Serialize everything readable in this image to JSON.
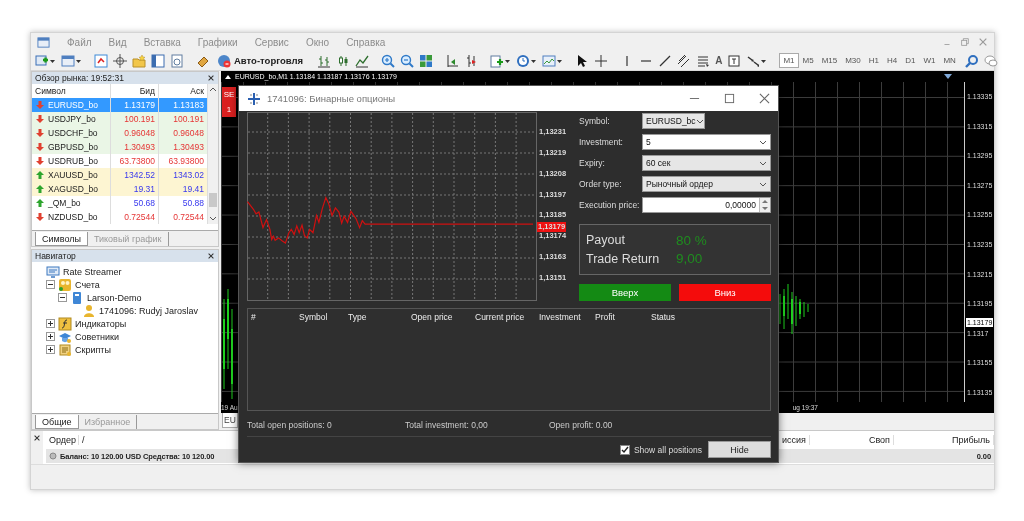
{
  "menu": [
    "Файл",
    "Вид",
    "Вставка",
    "Графики",
    "Сервис",
    "Окно",
    "Справка"
  ],
  "toolbar": {
    "auto_trading": "Авто-торговля",
    "text_tool": "A",
    "timeframes": [
      {
        "label": "M1",
        "selected": true
      },
      {
        "label": "M5",
        "selected": false
      },
      {
        "label": "M15",
        "selected": false
      },
      {
        "label": "M30",
        "selected": false
      },
      {
        "label": "H1",
        "selected": false
      },
      {
        "label": "H4",
        "selected": false
      },
      {
        "label": "D1",
        "selected": false
      },
      {
        "label": "W1",
        "selected": false
      },
      {
        "label": "MN",
        "selected": false
      }
    ]
  },
  "market_watch": {
    "title": "Обзор рынка: 19:52:31",
    "columns": [
      "Символ",
      "Бид",
      "Аск"
    ],
    "rows": [
      {
        "symbol": "EURUSD_bo",
        "bid": "1.13179",
        "ask": "1.13183",
        "kind": "down",
        "selected": true
      },
      {
        "symbol": "USDJPY_bo",
        "bid": "100.191",
        "ask": "100.191",
        "kind": "down",
        "selected": false,
        "color": "#eaf6e6"
      },
      {
        "symbol": "USDCHF_bo",
        "bid": "0.96048",
        "ask": "0.96048",
        "kind": "down",
        "selected": false,
        "color": "#eaf6e6"
      },
      {
        "symbol": "GBPUSD_bo",
        "bid": "1.30493",
        "ask": "1.30493",
        "kind": "down",
        "selected": false,
        "color": "#eaf6e6"
      },
      {
        "symbol": "USDRUB_bo",
        "bid": "63.73800",
        "ask": "63.93800",
        "kind": "down",
        "selected": false,
        "color": "#ffffff"
      },
      {
        "symbol": "XAUUSD_bo",
        "bid": "1342.52",
        "ask": "1343.02",
        "kind": "up",
        "selected": false,
        "color": "#fdf5d2"
      },
      {
        "symbol": "XAGUSD_bo",
        "bid": "19.31",
        "ask": "19.41",
        "kind": "up",
        "selected": false,
        "color": "#fdf5d2"
      },
      {
        "symbol": "_QM_bo",
        "bid": "50.68",
        "ask": "50.88",
        "kind": "up",
        "selected": false,
        "color": "#ffffff"
      },
      {
        "symbol": "NZDUSD_bo",
        "bid": "0.72544",
        "ask": "0.72544",
        "kind": "down",
        "selected": false,
        "color": "#ffffff"
      }
    ],
    "tabs": [
      {
        "label": "Символы",
        "selected": true
      },
      {
        "label": "Тиковый график",
        "selected": false
      }
    ]
  },
  "navigator": {
    "title": "Навигатор",
    "tree": [
      {
        "label": "Rate Streamer",
        "kind": "root",
        "children": [
          {
            "label": "Счета",
            "kind": "accounts",
            "expanded": true,
            "children": [
              {
                "label": "Larson-Demo",
                "kind": "server",
                "expanded": true,
                "children": [
                  {
                    "label": "1741096: Rudyj Jaroslav",
                    "kind": "account"
                  }
                ]
              }
            ]
          },
          {
            "label": "Индикаторы",
            "kind": "indicators",
            "expanded": false
          },
          {
            "label": "Советники",
            "kind": "experts",
            "expanded": false
          },
          {
            "label": "Скрипты",
            "kind": "scripts",
            "expanded": false
          }
        ]
      }
    ],
    "tabs": [
      {
        "label": "Общие",
        "selected": true
      },
      {
        "label": "Избранное",
        "selected": false
      }
    ]
  },
  "chart": {
    "title": "EURUSD_bo,M1 1.13184 1.13187 1.13176 1.13179",
    "sell_label": "SE",
    "sell_price": "1",
    "price_labels": [
      "1.13335",
      "1.13315",
      "1.13295",
      "1.13275",
      "1.13255",
      "1.13235",
      "1.13215",
      "1.13195",
      "1.1317",
      "1.13155",
      "1.13135"
    ],
    "current_price": "1.13179",
    "time_labels": [
      "19 Au",
      "ug 19:37"
    ],
    "tab": "EU"
  },
  "dialog": {
    "title": "1741096: Бинарные опционы",
    "price_labels": [
      "1,13231",
      "1,13219",
      "1,13208",
      "1,13197",
      "1,13185",
      "1,13174",
      "1,13163",
      "1,13151"
    ],
    "current_price": "1,13179",
    "form": [
      {
        "label": "Symbol:",
        "value": "EURUSD_bc",
        "kind": "short-select"
      },
      {
        "label": "Investment:",
        "value": "5",
        "kind": "combo"
      },
      {
        "label": "Expiry:",
        "value": "60 сек",
        "kind": "dropdown"
      },
      {
        "label": "Order type:",
        "value": "Рыночный ордер",
        "kind": "dropdown"
      },
      {
        "label": "Execution price:",
        "value": "0,00000",
        "kind": "spin"
      }
    ],
    "payout": {
      "label": "Payout",
      "value": "80 %"
    },
    "trade_return": {
      "label": "Trade Return",
      "value": "9,00"
    },
    "buttons": [
      {
        "label": "Вверх",
        "kind": "up"
      },
      {
        "label": "Вниз",
        "kind": "down"
      }
    ],
    "positions_columns": [
      "#",
      "Symbol",
      "Type",
      "Open price",
      "Current price",
      "Investment",
      "Profit",
      "Status"
    ],
    "totals": [
      {
        "label": "Total open positions:",
        "value": "0"
      },
      {
        "label": "Total investment:",
        "value": "0,00"
      },
      {
        "label": "Open profit:",
        "value": "0.00"
      }
    ],
    "show_all": {
      "label": "Show all positions",
      "checked": true
    },
    "hide_button": "Hide"
  },
  "terminal": {
    "columns": [
      "Ордер",
      "/",
      "иссия",
      "Своп",
      "Прибыль"
    ],
    "balance": "Баланс: 10 120.00 USD  Средства: 10 120.00",
    "profit": "0.00"
  }
}
